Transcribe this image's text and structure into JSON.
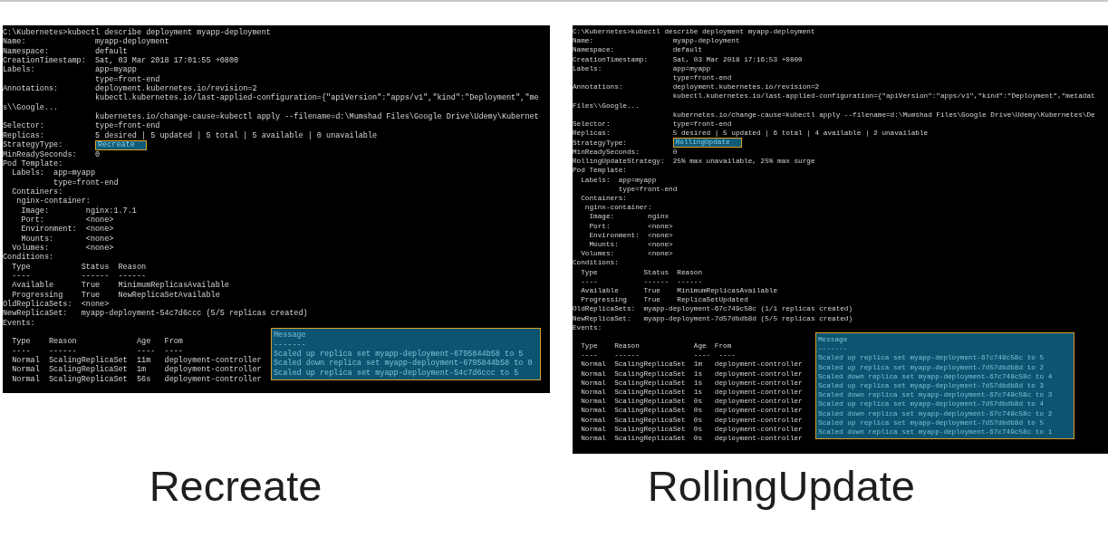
{
  "terminals": [
    {
      "head_lines": [
        "C:\\Kubernetes>kubectl describe deployment myapp-deployment",
        "Name:               myapp-deployment",
        "Namespace:          default",
        "CreationTimestamp:  Sat, 03 Mar 2018 17:01:55 +0800",
        "Labels:             app=myapp",
        "                    type=front-end",
        "Annotations:        deployment.kubernetes.io/revision=2",
        "                    kubectl.kubernetes.io/last-applied-configuration={\"apiVersion\":\"apps/v1\",\"kind\":\"Deployment\",\"me",
        "s\\\\Google...",
        "                    kubernetes.io/change-cause=kubectl apply --filename=d:\\Mumshad Files\\Google Drive\\Udemy\\Kubernet",
        "Selector:           type=front-end",
        "Replicas:           5 desired | 5 updated | 5 total | 5 available | 0 unavailable"
      ],
      "strategy": {
        "label": "StrategyType:",
        "value": "Recreate"
      },
      "body_lines": [
        "MinReadySeconds:    0",
        "Pod Template:",
        "  Labels:  app=myapp",
        "           type=front-end",
        "  Containers:",
        "   nginx-container:",
        "    Image:        nginx:1.7.1",
        "    Port:         <none>",
        "    Environment:  <none>",
        "    Mounts:       <none>",
        "  Volumes:        <none>",
        "Conditions:",
        "  Type           Status  Reason",
        "  ----           ------  ------",
        "  Available      True    MinimumReplicasAvailable",
        "  Progressing    True    NewReplicaSetAvailable",
        "OldReplicaSets:  <none>",
        "NewReplicaSet:   myapp-deployment-54c7d6ccc (5/5 replicas created)",
        "Events:"
      ],
      "events": {
        "header": "  Type    Reason             Age   From",
        "dashes": "  ----    ------             ----  ----",
        "message_header": "Message",
        "message_dashes": "-------",
        "rows": [
          {
            "text": "  Normal  ScalingReplicaSet  11m   deployment-controller",
            "message": "Scaled up replica set myapp-deployment-6795844b58 to 5"
          },
          {
            "text": "  Normal  ScalingReplicaSet  1m    deployment-controller",
            "message": "Scaled down replica set myapp-deployment-6795844b58 to 0"
          },
          {
            "text": "  Normal  ScalingReplicaSet  56s   deployment-controller",
            "message": "Scaled up replica set myapp-deployment-54c7d6ccc to 5"
          }
        ]
      },
      "caption": "Recreate"
    },
    {
      "head_lines": [
        "C:\\Kubernetes>kubectl describe deployment myapp-deployment",
        "Name:                   myapp-deployment",
        "Namespace:              default",
        "CreationTimestamp:      Sat, 03 Mar 2018 17:16:53 +0800",
        "Labels:                 app=myapp",
        "                        type=front-end",
        "Annotations:            deployment.kubernetes.io/revision=2",
        "                        kubectl.kubernetes.io/last-applied-configuration={\"apiVersion\":\"apps/v1\",\"kind\":\"Deployment\",\"metadat",
        "Files\\\\Google...",
        "                        kubernetes.io/change-cause=kubectl apply --filename=d:\\Mumshad Files\\Google Drive\\Udemy\\Kubernetes\\De",
        "Selector:               type=front-end",
        "Replicas:               5 desired | 5 updated | 6 total | 4 available | 2 unavailable"
      ],
      "strategy": {
        "label": "StrategyType:",
        "value": "RollingUpdate"
      },
      "body_lines": [
        "MinReadySeconds:        0",
        "RollingUpdateStrategy:  25% max unavailable, 25% max surge",
        "Pod Template:",
        "  Labels:  app=myapp",
        "           type=front-end",
        "  Containers:",
        "   nginx-container:",
        "    Image:        nginx",
        "    Port:         <none>",
        "    Environment:  <none>",
        "    Mounts:       <none>",
        "  Volumes:        <none>",
        "Conditions:",
        "  Type           Status  Reason",
        "  ----           ------  ------",
        "  Available      True    MinimumReplicasAvailable",
        "  Progressing    True    ReplicaSetUpdated",
        "OldReplicaSets:  myapp-deployment-67c749c58c (1/1 replicas created)",
        "NewReplicaSet:   myapp-deployment-7d57dbdb8d (5/5 replicas created)",
        "Events:"
      ],
      "events": {
        "header": "  Type    Reason             Age  From",
        "dashes": "  ----    ------             ----  ----",
        "message_header": "Message",
        "message_dashes": "-------",
        "rows": [
          {
            "text": "  Normal  ScalingReplicaSet  1m   deployment-controller",
            "message": "Scaled up replica set myapp-deployment-67c749c58c to 5"
          },
          {
            "text": "  Normal  ScalingReplicaSet  1s   deployment-controller",
            "message": "Scaled up replica set myapp-deployment-7d57dbdb8d to 2"
          },
          {
            "text": "  Normal  ScalingReplicaSet  1s   deployment-controller",
            "message": "Scaled down replica set myapp-deployment-67c749c58c to 4"
          },
          {
            "text": "  Normal  ScalingReplicaSet  1s   deployment-controller",
            "message": "Scaled up replica set myapp-deployment-7d57dbdb8d to 3"
          },
          {
            "text": "  Normal  ScalingReplicaSet  0s   deployment-controller",
            "message": "Scaled down replica set myapp-deployment-67c749c58c to 3"
          },
          {
            "text": "  Normal  ScalingReplicaSet  0s   deployment-controller",
            "message": "Scaled up replica set myapp-deployment-7d57dbdb8d to 4"
          },
          {
            "text": "  Normal  ScalingReplicaSet  0s   deployment-controller",
            "message": "Scaled down replica set myapp-deployment-67c749c58c to 2"
          },
          {
            "text": "  Normal  ScalingReplicaSet  0s   deployment-controller",
            "message": "Scaled up replica set myapp-deployment-7d57dbdb8d to 5"
          },
          {
            "text": "  Normal  ScalingReplicaSet  0s   deployment-controller",
            "message": "Scaled down replica set myapp-deployment-67c749c58c to 1"
          }
        ]
      },
      "caption": "RollingUpdate"
    }
  ]
}
